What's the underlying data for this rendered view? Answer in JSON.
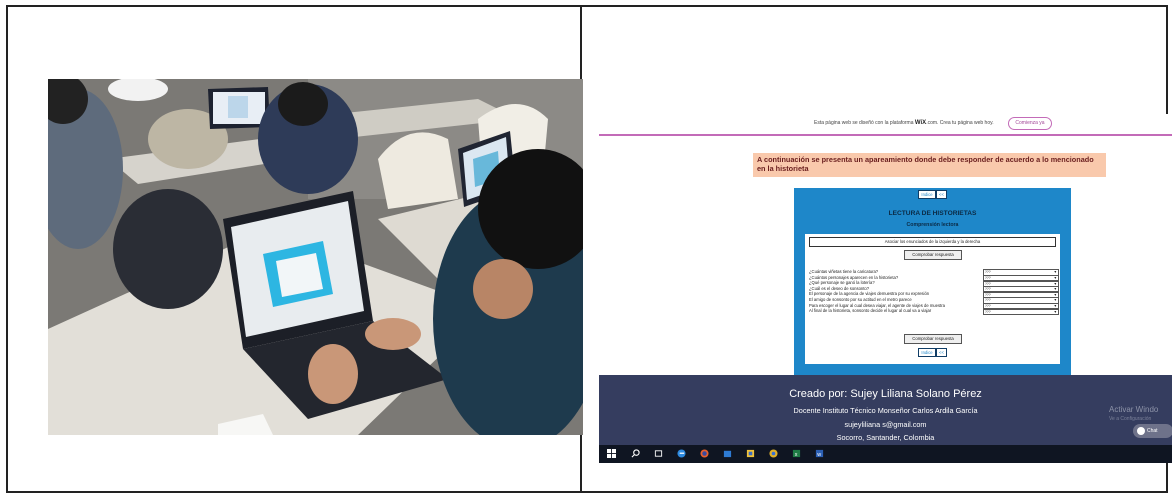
{
  "left_photo": {
    "alt": ""
  },
  "screenshot": {
    "wix_banner": {
      "text_before": "Esta página web se diseñó con la plataforma",
      "brand": "WiX",
      "text_after": ".com. Crea tu página web hoy.",
      "button_label": "Comienza ya"
    },
    "instruction": "A continuación se presenta un apareamiento donde debe responder de acuerdo a lo mencionado en la historieta",
    "quiz": {
      "nav_top": [
        "Indice",
        "<<"
      ],
      "title": "LECTURA DE HISTORIETAS",
      "subtitle": "Comprensión lectora",
      "assoc_label": "Asociar los enunciados de la izquierda y la derecha",
      "check_label_top": "Comprobar respuesta",
      "check_label_bottom": "Comprobar respuesta",
      "nav_bottom": [
        "Indice",
        "<<"
      ],
      "select_placeholder": "???",
      "questions": [
        "¿Cuántas viñetas tiene la caricatura?",
        "¿Cuántos personajes aparecen en la historieta?",
        "¿Qué personaje se ganó la lotería?",
        "¿Cuál es el deseo de sonsonto?",
        "El personaje de la agencia de viajes demuestra por su expresión",
        "El amigo de sonsonto por su actitud en el metro parece",
        "Para escoger el lugar al cual desea viajar, el agente de viajes de muestra",
        "Al final de la historieta, sonsonto decide el lugar al cual va a viajar"
      ]
    },
    "footer": {
      "created_by": "Creado por: Sujey Liliana Solano Pérez",
      "role": "Docente Instituto Técnico Monseñor Carlos Ardila García",
      "email": "sujeyliliana s@gmail.com",
      "place": "Socorro, Santander, Colombia",
      "activate": "Activar Windo",
      "activate_sub": "Ve a Configuración",
      "chat": "Chat"
    }
  }
}
